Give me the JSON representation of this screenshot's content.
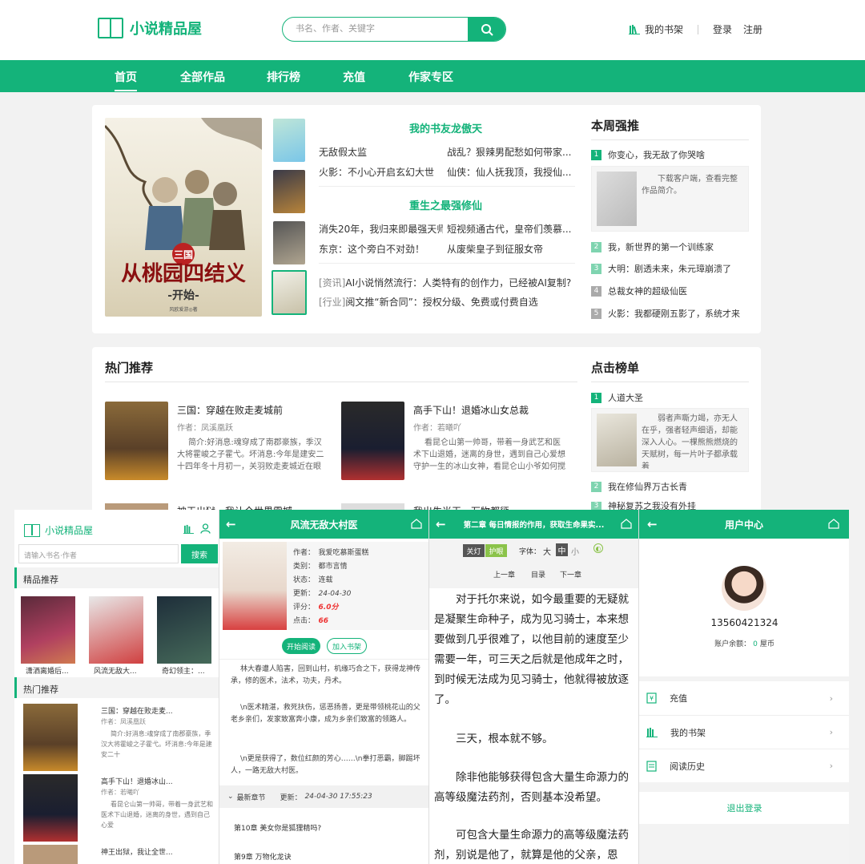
{
  "brand": "小说精品屋",
  "search": {
    "placeholder": "书名、作者、关键字"
  },
  "header": {
    "bookshelf": "我的书架",
    "login": "登录",
    "register": "注册"
  },
  "nav": [
    "首页",
    "全部作品",
    "排行榜",
    "充值",
    "作家专区"
  ],
  "featured": {
    "cover_title": "三国：从桃园四结义开始",
    "cover_title_line1": "三国",
    "cover_title_line2": "从桃园四结义",
    "cover_title_line3": "-开始-",
    "cover_author": "风欧爱游◎著",
    "heading1": "我的书友龙傲天",
    "list1": [
      [
        "无敌假太监",
        "战乱？狠辣男配愁如何带家..."
      ],
      [
        "火影：不小心开启玄幻大世",
        "仙侠：仙人抚我顶，我授仙..."
      ]
    ],
    "heading2": "重生之最强修仙",
    "list2": [
      [
        "消失20年，我归来即最强天师",
        "短视频通古代，皇帝们羡慕..."
      ],
      [
        "东京：这个旁白不对劲！",
        "从废柴皇子到征服女帝"
      ]
    ],
    "news": [
      {
        "tag": "[资讯]",
        "text": "AI小说悄然流行：人类特有的创作力，已经被AI复制?"
      },
      {
        "tag": "[行业]",
        "text": "阅文推“新合同”：授权分级、免费或付费自选"
      }
    ]
  },
  "weekly": {
    "title": "本周强推",
    "first": "你变心，我无敌了你哭啥",
    "first_desc": "下载客户端，查看完整作品简介。",
    "items": [
      "我，新世界的第一个训练家",
      "大明：剧透未来，朱元璋崩溃了",
      "总裁女神的超级仙医",
      "火影：我都硬刚五影了，系统才来"
    ]
  },
  "hot": {
    "title": "热门推荐",
    "books": [
      {
        "title": "三国：穿越在败走麦城前",
        "author": "作者：凤溪凰跃",
        "desc": "简介:好消息:魂穿成了南郡豪族，季汉大将霍峻之子霍弋。坏消息:今年是建安二十四年冬十月初一，关羽败走麦城近在眼前。"
      },
      {
        "title": "高手下山！退婚冰山女总裁",
        "author": "作者：若曦吖",
        "desc": "看昆仑山第一帅哥，带着一身武艺和医术下山退婚，迷离的身世，遇到自己心爱想守护一生的冰山女神，看昆仑山小爷如何搅"
      }
    ],
    "more": [
      "神王出狱，我让全世界震撼",
      "我出生当天，万物都惩"
    ]
  },
  "click": {
    "title": "点击榜单",
    "first": "人道大圣",
    "first_desc": "弱者声嘶力竭，亦无人在乎，强者轻声细语，却能深入人心。一棵熊熊燃烧的天赋树，每一片叶子都承载着",
    "items": [
      "我在修仙界万古长青",
      "神秘复苏之我没有外挂"
    ]
  },
  "m1": {
    "brand": "小说精品屋",
    "search_placeholder": "请输入书名·作者",
    "search_btn": "搜索",
    "sec1": "精品推荐",
    "books": [
      "潇洒离婚后...",
      "风流无敌大...",
      "奇幻领主：..."
    ],
    "sec2": "热门推荐",
    "hot": [
      {
        "title": "三国：穿越在败走麦...",
        "author": "作者：凤溪凰跃",
        "desc": "简介:好消息:魂穿成了南郡豪族，季汉大将霍峻之子霍弋。坏消息:今年是建安二十"
      },
      {
        "title": "高手下山！退婚冰山...",
        "author": "作者：若曦吖",
        "desc": "看昆仑山第一帅哥，带着一身武艺和医术下山退婚，迷离的身世，遇到自己心爱"
      }
    ],
    "more": "神王出狱，我让全世..."
  },
  "m2": {
    "title": "风流无敌大村医",
    "author": "作者：　我爱吃慕斯蛋糕",
    "category": "类别：　都市言情",
    "status": "状态：　连载",
    "updated_label": "更新：",
    "updated": "24-04-30",
    "score_label": "评分：",
    "score": "6.0分",
    "clicks_label": "点击：",
    "clicks": "66",
    "read_btn": "开始阅读",
    "shelf_btn": "加入书架",
    "p1": "林大春遭人陷害，回到山村，机缘巧合之下，获得龙神传承，修的医术，法术，功夫，丹术。",
    "p2": "\\n医术精湛，救死扶伤，惩恶扬善，更是带领桃花山的父老乡亲们，发家致富奔小康，成为乡亲们致富的领路人。",
    "p3": "\\n更是获得了，数位红颜的芳心……\\n拳打恶霸，脚踢坏人，一路无敌大村医。",
    "latest_label": "最新章节",
    "latest_time_label": "更新：",
    "latest_time": "24-04-30 17:55:23",
    "ch1": "第10章 美女你是狐狸精吗?",
    "ch2": "第9章 万物化龙诀"
  },
  "m3": {
    "title": "第二章 每日情报的作用，获取生命果实...",
    "light": "关灯",
    "eye": "护眼",
    "font_label": "字体：",
    "font_big": "大",
    "font_mid": "中",
    "font_small": "小",
    "prev": "上一章",
    "toc": "目录",
    "next": "下一章",
    "p1": "对于托尔来说，如今最重要的无疑就是凝聚生命种子，成为见习骑士，本来想要做到几乎很难了，以他目前的速度至少需要一年，可三天之后就是他成年之时，到时候无法成为见习骑士，他就得被放逐了。",
    "p2": "三天，根本就不够。",
    "p3": "除非他能够获得包含大量生命源力的高等级魔法药剂，否则基本没希望。",
    "p4": "可包含大量生命源力的高等级魔法药剂，别说是他了，就算是他的父亲，恩"
  },
  "m4": {
    "title": "用户中心",
    "phone": "13560421324",
    "balance_label": "账户余额：",
    "balance": "0",
    "balance_unit": "屋币",
    "menu": [
      "充值",
      "我的书架",
      "阅读历史"
    ],
    "logout": "退出登录"
  },
  "colors": {
    "accent": "#14b37a"
  }
}
